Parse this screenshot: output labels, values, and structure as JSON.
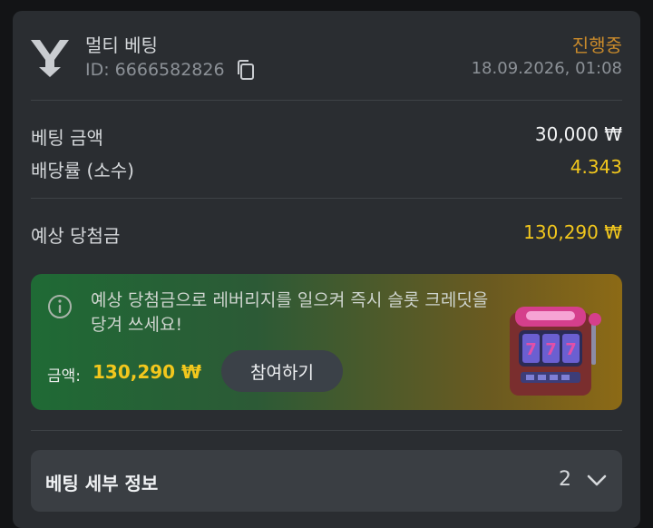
{
  "header": {
    "bet_type": "멀티 베팅",
    "bet_id": "ID: 6666582826",
    "status": "진행중",
    "datetime": "18.09.2026, 01:08"
  },
  "summary": {
    "stake_label": "베팅 금액",
    "stake_value": "30,000 ₩",
    "odds_label": "배당률 (소수)",
    "odds_value": "4.343",
    "payout_label": "예상 당첨금",
    "payout_value": "130,290 ₩"
  },
  "promo": {
    "text": "예상 당첨금으로 레버리지를 일으켜 즉시 슬롯 크레딧을 당겨 쓰세요!",
    "amount_label": "금액:",
    "amount_value": "130,290 ₩",
    "button_label": "참여하기"
  },
  "details": {
    "title": "베팅 세부 정보",
    "count": "2"
  },
  "colors": {
    "status": "#c98a2b",
    "accent_gold": "#f2c71d",
    "card_bg": "#2a2d31"
  },
  "icons": [
    "brand-logo-icon",
    "copy-icon",
    "info-icon",
    "slot-machine-icon",
    "chevron-down-icon"
  ]
}
